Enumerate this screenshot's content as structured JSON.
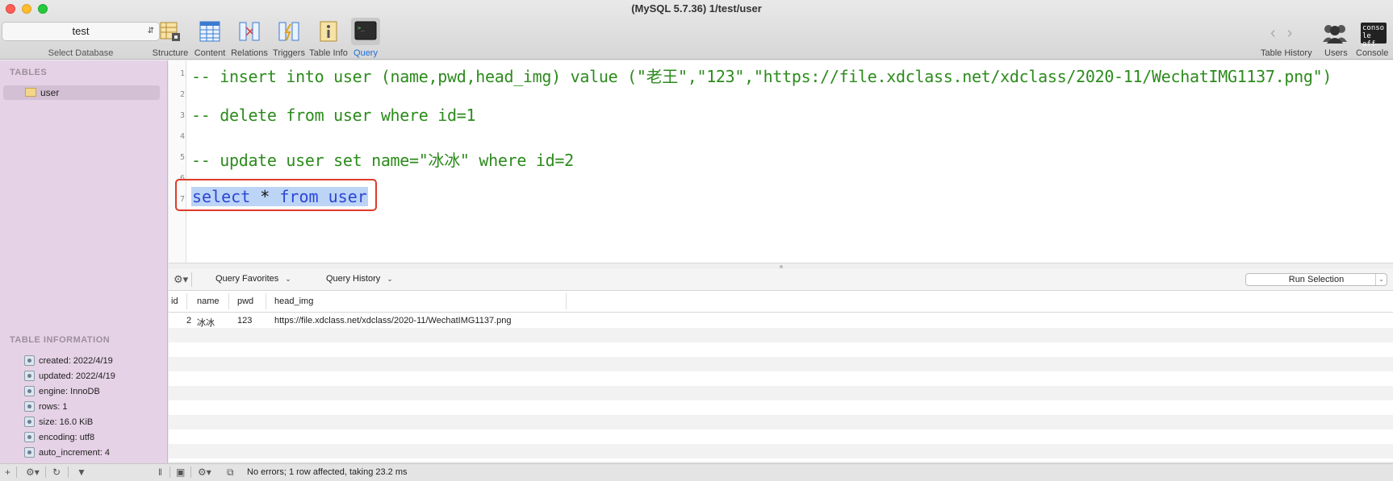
{
  "window": {
    "title": "(MySQL 5.7.36) 1/test/user"
  },
  "database": {
    "selected": "test",
    "caption": "Select Database"
  },
  "toolbar": {
    "tools": [
      {
        "label": "Structure",
        "icon": "structure-icon"
      },
      {
        "label": "Content",
        "icon": "content-icon"
      },
      {
        "label": "Relations",
        "icon": "relations-icon"
      },
      {
        "label": "Triggers",
        "icon": "triggers-icon"
      },
      {
        "label": "Table Info",
        "icon": "table-info-icon"
      },
      {
        "label": "Query",
        "icon": "query-icon",
        "active": true
      }
    ],
    "right": {
      "history": "Table History",
      "users": "Users",
      "console": "Console",
      "console_icon_text": "conso le off"
    }
  },
  "sidebar": {
    "tables_header": "TABLES",
    "tables": [
      {
        "name": "user"
      }
    ],
    "info_header": "TABLE INFORMATION",
    "info": [
      "created: 2022/4/19",
      "updated: 2022/4/19",
      "engine: InnoDB",
      "rows: 1",
      "size: 16.0 KiB",
      "encoding: utf8",
      "auto_increment: 4"
    ]
  },
  "editor": {
    "line_numbers": [
      "1",
      "2",
      "3",
      "4",
      "5",
      "6",
      "7"
    ],
    "lines": [
      "-- insert into user (name,pwd,head_img) value (\"老王\",\"123\",\"https://file.xdclass.net/xdclass/2020-11/WechatIMG1137.png\")",
      "",
      "-- delete from user where id=1",
      "",
      "-- update user set name=\"冰冰\" where id=2",
      ""
    ],
    "selected_line": {
      "kw1": "select",
      "op": "*",
      "kw2": "from",
      "kw3": "user"
    }
  },
  "query_bar": {
    "favorites": "Query Favorites",
    "history": "Query History",
    "run": "Run Selection"
  },
  "results": {
    "columns": [
      "id",
      "name",
      "pwd",
      "head_img"
    ],
    "rows": [
      {
        "id": "2",
        "name": "冰冰",
        "pwd": "123",
        "head_img": "https://file.xdclass.net/xdclass/2020-11/WechatIMG1137.png"
      }
    ]
  },
  "status": {
    "message": "No errors; 1 row affected, taking 23.2 ms"
  },
  "colors": {
    "sidebar": "#e6d2e6",
    "comment": "#2c8b1c",
    "keyword": "#2b45d8",
    "highlight_box": "#e03a2a",
    "selection": "#bcd4f5"
  }
}
